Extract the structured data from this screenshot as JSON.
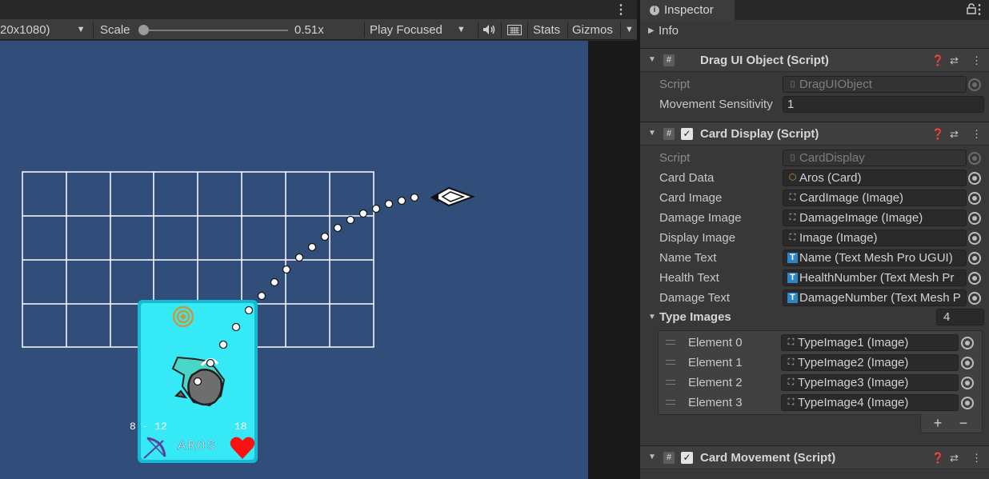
{
  "game": {
    "resolution": "20x1080)",
    "scale_label": "Scale",
    "scale_value": "0.51x",
    "scale_fraction": 0.0,
    "play_mode": "Play Focused",
    "stats_label": "Stats",
    "gizmos_label": "Gizmos"
  },
  "card": {
    "damage_range": "8 - 12",
    "health": "18",
    "name": "AROS"
  },
  "inspector": {
    "tab_title": "Inspector",
    "info_label": "Info",
    "drag_component": {
      "title": "Drag UI Object (Script)",
      "script_label": "Script",
      "script_value": "DragUIObject",
      "sensitivity_label": "Movement Sensitivity",
      "sensitivity_value": "1"
    },
    "card_display": {
      "title": "Card Display (Script)",
      "script_label": "Script",
      "script_value": "CardDisplay",
      "fields": [
        {
          "label": "Card Data",
          "value": "Aros (Card)",
          "icon": "scriptable-object-icon"
        },
        {
          "label": "Card Image",
          "value": "CardImage (Image)",
          "icon": "image-component-icon"
        },
        {
          "label": "Damage Image",
          "value": "DamageImage (Image)",
          "icon": "image-component-icon"
        },
        {
          "label": "Display Image",
          "value": "Image (Image)",
          "icon": "image-component-icon"
        },
        {
          "label": "Name Text",
          "value": "Name (Text Mesh Pro UGUI)",
          "icon": "textmeshpro-icon"
        },
        {
          "label": "Health Text",
          "value": "HealthNumber (Text Mesh Pr",
          "icon": "textmeshpro-icon"
        },
        {
          "label": "Damage Text",
          "value": "DamageNumber (Text Mesh P",
          "icon": "textmeshpro-icon"
        }
      ],
      "type_images_label": "Type Images",
      "type_images_count": "4",
      "elements": [
        {
          "label": "Element 0",
          "value": "TypeImage1 (Image)"
        },
        {
          "label": "Element 1",
          "value": "TypeImage2 (Image)"
        },
        {
          "label": "Element 2",
          "value": "TypeImage3 (Image)"
        },
        {
          "label": "Element 3",
          "value": "TypeImage4 (Image)"
        }
      ],
      "add_label": "+",
      "remove_label": "−"
    },
    "card_movement": {
      "title": "Card Movement (Script)"
    }
  },
  "colors": {
    "game_bg": "#314d79",
    "card_fill": "#19dcf0",
    "grid_line": "#ffffff",
    "heart": "#ff1010"
  }
}
